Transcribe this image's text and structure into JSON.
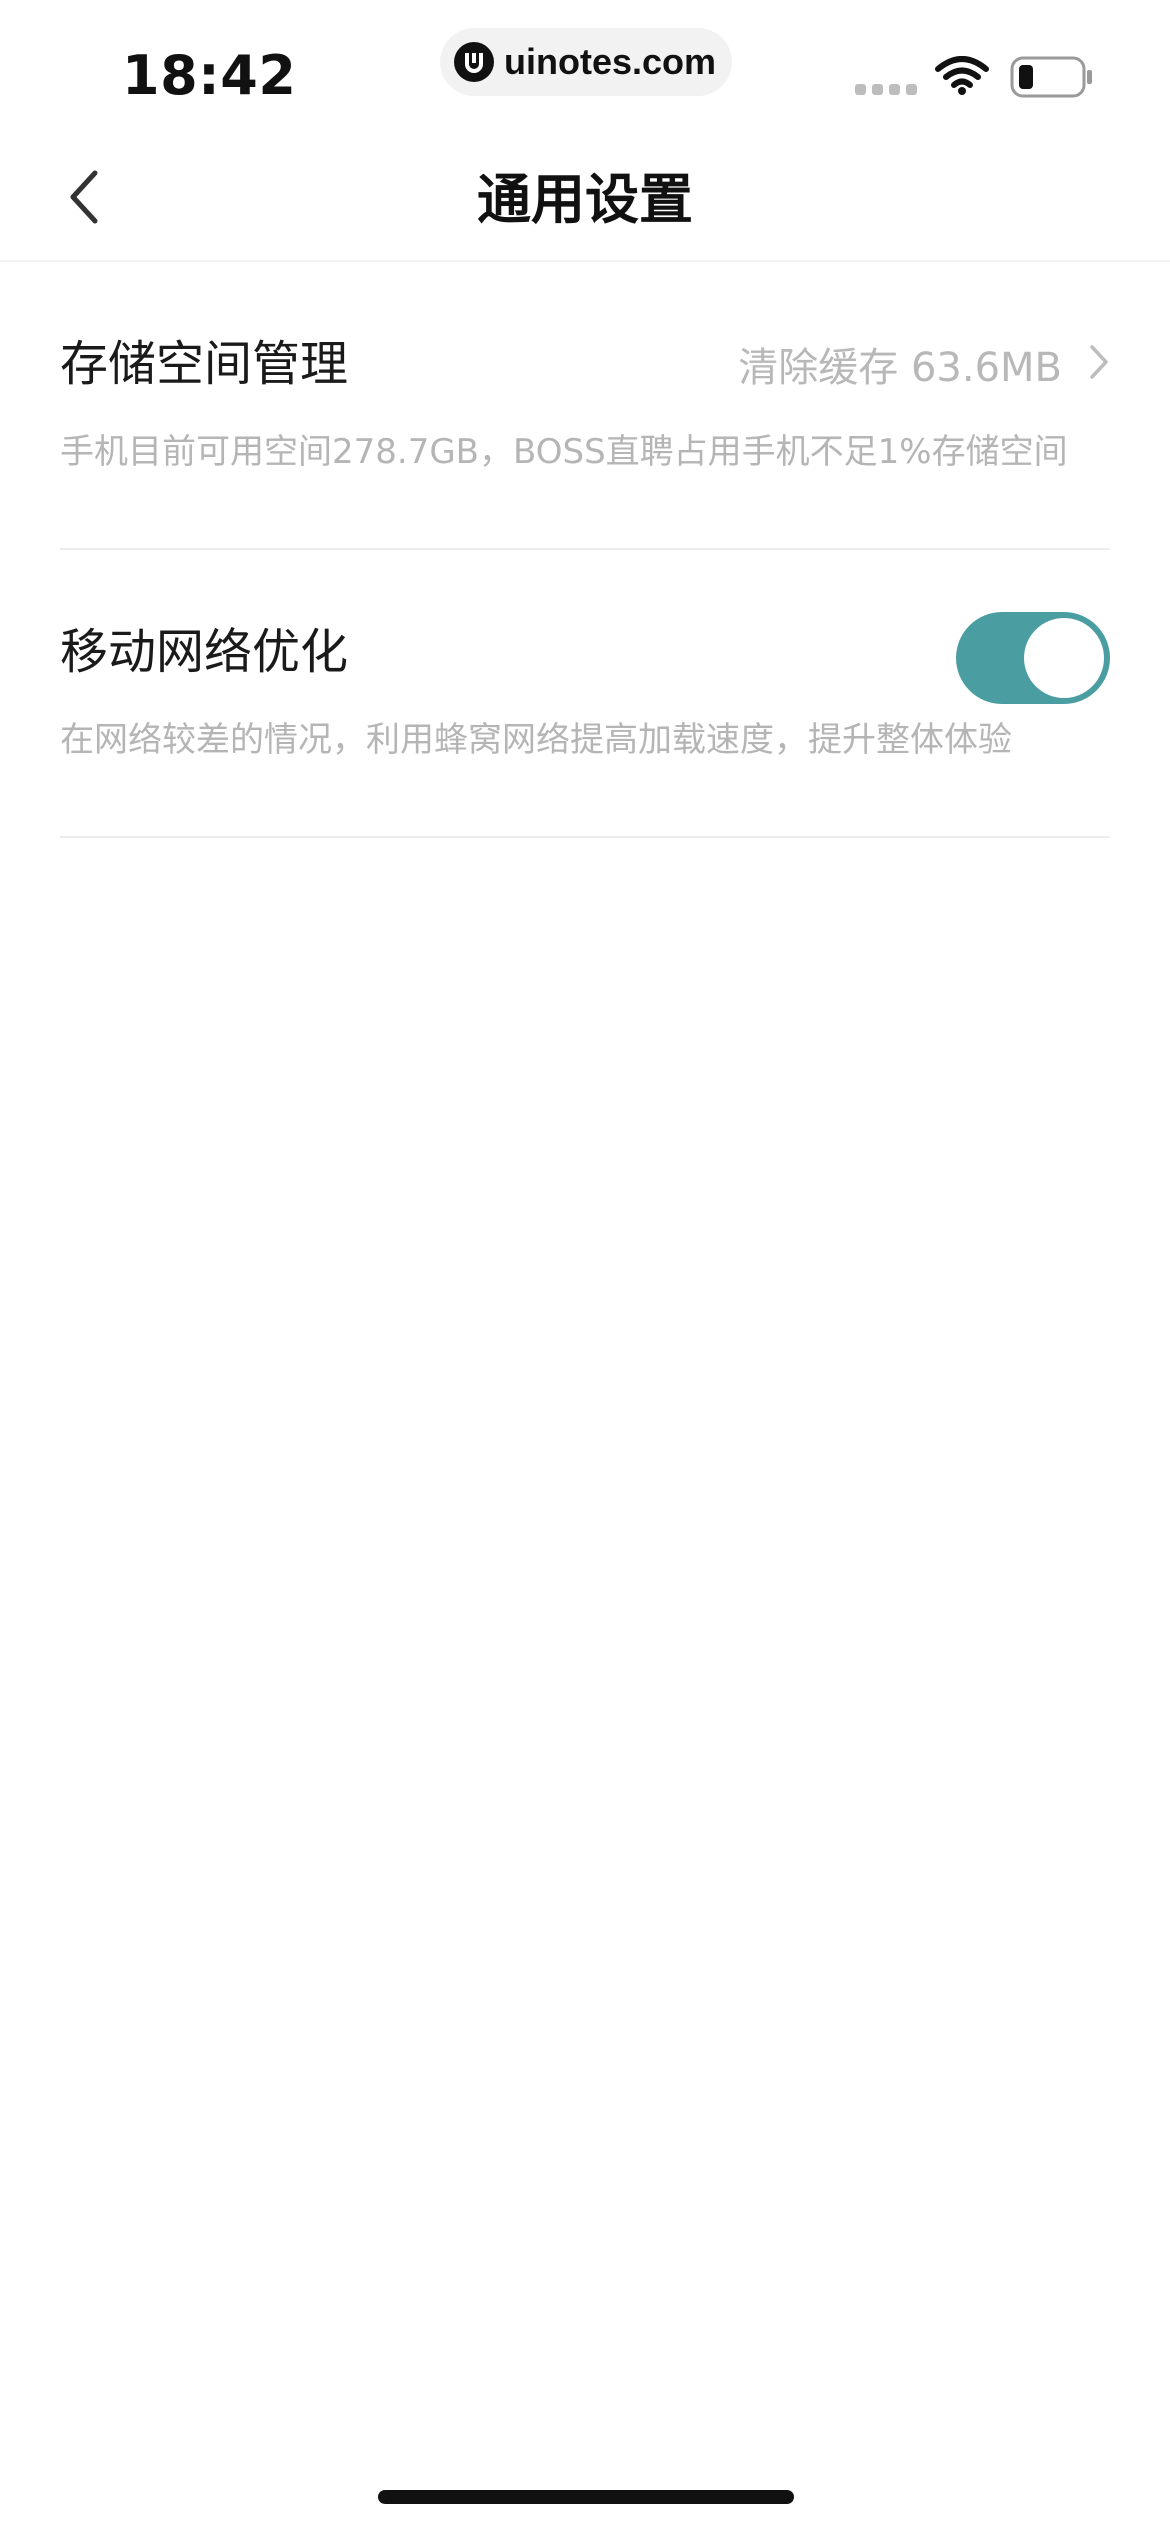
{
  "status_bar": {
    "time": "18:42",
    "url": "uinotes.com",
    "logo_icon": "uinotes-logo-icon",
    "wifi_icon": "wifi-icon",
    "battery_icon": "battery-icon"
  },
  "nav": {
    "back_icon": "chevron-left-icon",
    "title": "通用设置"
  },
  "settings": [
    {
      "title": "存储空间管理",
      "description": "手机目前可用空间278.7GB，BOSS直聘占用手机不足1%存储空间",
      "action_label": "清除缓存 63.6MB",
      "action_icon": "chevron-right-icon"
    },
    {
      "title": "移动网络优化",
      "description": "在网络较差的情况，利用蜂窝网络提高加载速度，提升整体体验",
      "toggle_on": true
    }
  ],
  "colors": {
    "toggle_on": "#4a9ea1",
    "secondary_text": "#b5b5b5",
    "primary_text": "#1a1a1a",
    "divider": "#ececec"
  }
}
